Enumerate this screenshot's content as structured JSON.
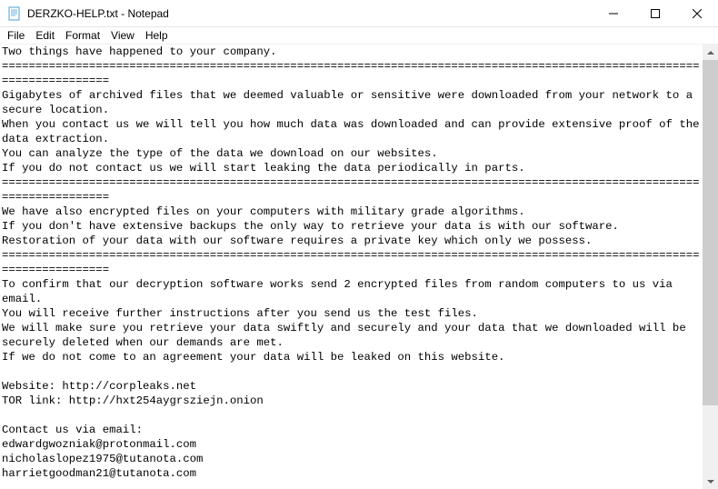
{
  "titlebar": {
    "title": "DERZKO-HELP.txt - Notepad"
  },
  "menubar": {
    "items": [
      "File",
      "Edit",
      "Format",
      "View",
      "Help"
    ]
  },
  "content": {
    "text": "Two things have happened to your company.\n========================================================================================================================\nGigabytes of archived files that we deemed valuable or sensitive were downloaded from your network to a secure location.\nWhen you contact us we will tell you how much data was downloaded and can provide extensive proof of the data extraction.\nYou can analyze the type of the data we download on our websites.\nIf you do not contact us we will start leaking the data periodically in parts.\n========================================================================================================================\nWe have also encrypted files on your computers with military grade algorithms.\nIf you don't have extensive backups the only way to retrieve your data is with our software.\nRestoration of your data with our software requires a private key which only we possess.\n========================================================================================================================\nTo confirm that our decryption software works send 2 encrypted files from random computers to us via email.\nYou will receive further instructions after you send us the test files.\nWe will make sure you retrieve your data swiftly and securely and your data that we downloaded will be securely deleted when our demands are met.\nIf we do not come to an agreement your data will be leaked on this website.\n\nWebsite: http://corpleaks.net\nTOR link: http://hxt254aygrsziejn.onion\n\nContact us via email:\nedwardgwozniak@protonmail.com\nnicholaslopez1975@tutanota.com\nharrietgoodman21@tutanota.com"
  }
}
